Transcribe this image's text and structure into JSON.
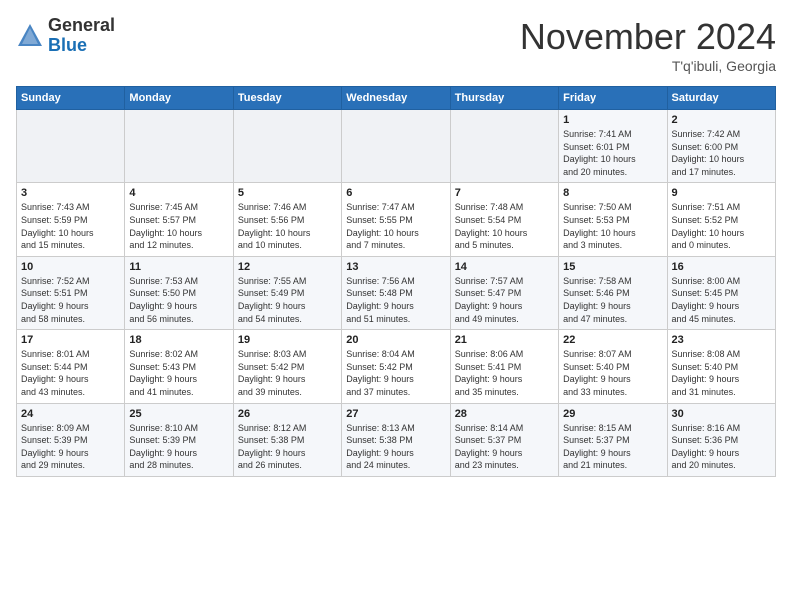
{
  "header": {
    "logo_line1": "General",
    "logo_line2": "Blue",
    "month": "November 2024",
    "location": "T'q'ibuli, Georgia"
  },
  "weekdays": [
    "Sunday",
    "Monday",
    "Tuesday",
    "Wednesday",
    "Thursday",
    "Friday",
    "Saturday"
  ],
  "weeks": [
    [
      {
        "day": "",
        "info": ""
      },
      {
        "day": "",
        "info": ""
      },
      {
        "day": "",
        "info": ""
      },
      {
        "day": "",
        "info": ""
      },
      {
        "day": "",
        "info": ""
      },
      {
        "day": "1",
        "info": "Sunrise: 7:41 AM\nSunset: 6:01 PM\nDaylight: 10 hours\nand 20 minutes."
      },
      {
        "day": "2",
        "info": "Sunrise: 7:42 AM\nSunset: 6:00 PM\nDaylight: 10 hours\nand 17 minutes."
      }
    ],
    [
      {
        "day": "3",
        "info": "Sunrise: 7:43 AM\nSunset: 5:59 PM\nDaylight: 10 hours\nand 15 minutes."
      },
      {
        "day": "4",
        "info": "Sunrise: 7:45 AM\nSunset: 5:57 PM\nDaylight: 10 hours\nand 12 minutes."
      },
      {
        "day": "5",
        "info": "Sunrise: 7:46 AM\nSunset: 5:56 PM\nDaylight: 10 hours\nand 10 minutes."
      },
      {
        "day": "6",
        "info": "Sunrise: 7:47 AM\nSunset: 5:55 PM\nDaylight: 10 hours\nand 7 minutes."
      },
      {
        "day": "7",
        "info": "Sunrise: 7:48 AM\nSunset: 5:54 PM\nDaylight: 10 hours\nand 5 minutes."
      },
      {
        "day": "8",
        "info": "Sunrise: 7:50 AM\nSunset: 5:53 PM\nDaylight: 10 hours\nand 3 minutes."
      },
      {
        "day": "9",
        "info": "Sunrise: 7:51 AM\nSunset: 5:52 PM\nDaylight: 10 hours\nand 0 minutes."
      }
    ],
    [
      {
        "day": "10",
        "info": "Sunrise: 7:52 AM\nSunset: 5:51 PM\nDaylight: 9 hours\nand 58 minutes."
      },
      {
        "day": "11",
        "info": "Sunrise: 7:53 AM\nSunset: 5:50 PM\nDaylight: 9 hours\nand 56 minutes."
      },
      {
        "day": "12",
        "info": "Sunrise: 7:55 AM\nSunset: 5:49 PM\nDaylight: 9 hours\nand 54 minutes."
      },
      {
        "day": "13",
        "info": "Sunrise: 7:56 AM\nSunset: 5:48 PM\nDaylight: 9 hours\nand 51 minutes."
      },
      {
        "day": "14",
        "info": "Sunrise: 7:57 AM\nSunset: 5:47 PM\nDaylight: 9 hours\nand 49 minutes."
      },
      {
        "day": "15",
        "info": "Sunrise: 7:58 AM\nSunset: 5:46 PM\nDaylight: 9 hours\nand 47 minutes."
      },
      {
        "day": "16",
        "info": "Sunrise: 8:00 AM\nSunset: 5:45 PM\nDaylight: 9 hours\nand 45 minutes."
      }
    ],
    [
      {
        "day": "17",
        "info": "Sunrise: 8:01 AM\nSunset: 5:44 PM\nDaylight: 9 hours\nand 43 minutes."
      },
      {
        "day": "18",
        "info": "Sunrise: 8:02 AM\nSunset: 5:43 PM\nDaylight: 9 hours\nand 41 minutes."
      },
      {
        "day": "19",
        "info": "Sunrise: 8:03 AM\nSunset: 5:42 PM\nDaylight: 9 hours\nand 39 minutes."
      },
      {
        "day": "20",
        "info": "Sunrise: 8:04 AM\nSunset: 5:42 PM\nDaylight: 9 hours\nand 37 minutes."
      },
      {
        "day": "21",
        "info": "Sunrise: 8:06 AM\nSunset: 5:41 PM\nDaylight: 9 hours\nand 35 minutes."
      },
      {
        "day": "22",
        "info": "Sunrise: 8:07 AM\nSunset: 5:40 PM\nDaylight: 9 hours\nand 33 minutes."
      },
      {
        "day": "23",
        "info": "Sunrise: 8:08 AM\nSunset: 5:40 PM\nDaylight: 9 hours\nand 31 minutes."
      }
    ],
    [
      {
        "day": "24",
        "info": "Sunrise: 8:09 AM\nSunset: 5:39 PM\nDaylight: 9 hours\nand 29 minutes."
      },
      {
        "day": "25",
        "info": "Sunrise: 8:10 AM\nSunset: 5:39 PM\nDaylight: 9 hours\nand 28 minutes."
      },
      {
        "day": "26",
        "info": "Sunrise: 8:12 AM\nSunset: 5:38 PM\nDaylight: 9 hours\nand 26 minutes."
      },
      {
        "day": "27",
        "info": "Sunrise: 8:13 AM\nSunset: 5:38 PM\nDaylight: 9 hours\nand 24 minutes."
      },
      {
        "day": "28",
        "info": "Sunrise: 8:14 AM\nSunset: 5:37 PM\nDaylight: 9 hours\nand 23 minutes."
      },
      {
        "day": "29",
        "info": "Sunrise: 8:15 AM\nSunset: 5:37 PM\nDaylight: 9 hours\nand 21 minutes."
      },
      {
        "day": "30",
        "info": "Sunrise: 8:16 AM\nSunset: 5:36 PM\nDaylight: 9 hours\nand 20 minutes."
      }
    ]
  ]
}
